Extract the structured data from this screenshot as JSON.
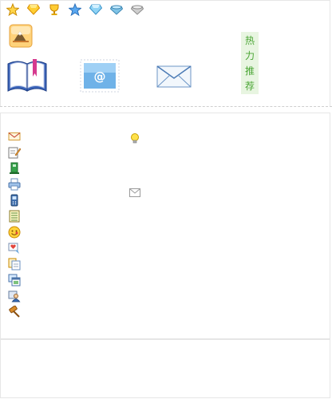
{
  "rank_icons": [
    "star-icon",
    "ruby-diamond-icon",
    "gold-trophy-icon",
    "blue-star-icon",
    "blue-diamond-icon",
    "teal-gem-icon",
    "silver-crown-icon"
  ],
  "hot_recommend": {
    "chars": [
      "热",
      "力",
      "推",
      "荐"
    ]
  },
  "colors": {
    "accent_green": "#4aa534",
    "hot_bg": "#e8f5e1",
    "border": "#e6e6e6"
  },
  "tool_icons": [
    "mail-icon",
    "edit-note-icon",
    "green-tower-icon",
    "print-icon",
    "mobile-phone-icon",
    "notepad-icon",
    "smiley-icon",
    "heart-message-icon",
    "copy-page-icon",
    "window-list-icon",
    "user-group-icon",
    "hammer-icon"
  ],
  "side_icons": [
    "lightbulb-icon",
    "small-mail-icon"
  ]
}
